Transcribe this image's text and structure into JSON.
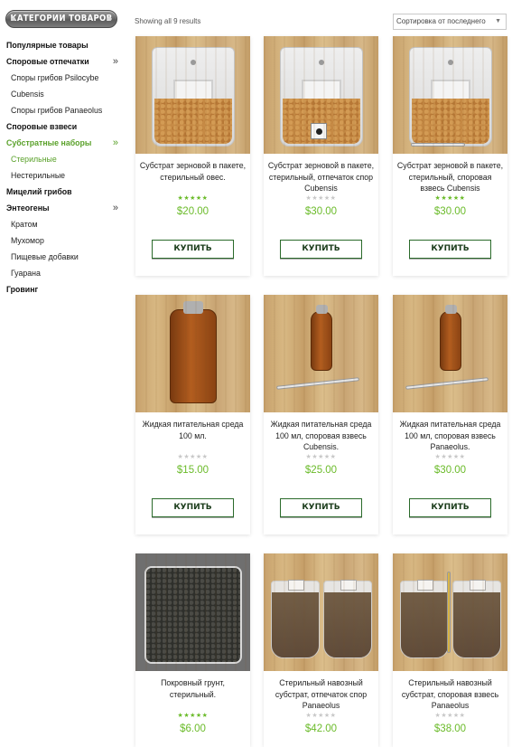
{
  "sidebar": {
    "header": "Категории товаров",
    "items": [
      {
        "label": "Популярные товары",
        "level": "top",
        "chevron": false,
        "active": false
      },
      {
        "label": "Споровые отпечатки",
        "level": "top",
        "chevron": true,
        "active": false
      },
      {
        "label": "Споры грибов Psilocybe",
        "level": "sub",
        "chevron": false,
        "active": false
      },
      {
        "label": "Cubensis",
        "level": "sub",
        "chevron": false,
        "active": false
      },
      {
        "label": "Споры грибов Panaeolus",
        "level": "sub",
        "chevron": false,
        "active": false
      },
      {
        "label": "Споровые взвеси",
        "level": "top",
        "chevron": false,
        "active": false
      },
      {
        "label": "Субстратные наборы",
        "level": "top",
        "chevron": true,
        "active": true
      },
      {
        "label": "Стерильные",
        "level": "sub",
        "chevron": false,
        "active": true
      },
      {
        "label": "Нестерильные",
        "level": "sub",
        "chevron": false,
        "active": false
      },
      {
        "label": "Мицелий грибов",
        "level": "top",
        "chevron": false,
        "active": false
      },
      {
        "label": "Энтеогены",
        "level": "top",
        "chevron": true,
        "active": false
      },
      {
        "label": "Кратом",
        "level": "sub",
        "chevron": false,
        "active": false
      },
      {
        "label": "Мухомор",
        "level": "sub",
        "chevron": false,
        "active": false
      },
      {
        "label": "Пищевые добавки",
        "level": "sub",
        "chevron": false,
        "active": false
      },
      {
        "label": "Гуарана",
        "level": "sub",
        "chevron": false,
        "active": false
      },
      {
        "label": "Гровинг",
        "level": "top",
        "chevron": false,
        "active": false
      }
    ]
  },
  "toolbar": {
    "result_count": "Showing all 9 results",
    "sort_selected": "Сортировка от последнего"
  },
  "products": [
    {
      "title": "Субстрат зерновой в пакете, стерильный овес.",
      "price": "$20.00",
      "rating": 5,
      "button": "Купить",
      "image": "grain-bag"
    },
    {
      "title": "Субстрат зерновой в пакете, стерильный, отпечаток спор Cubensis",
      "price": "$30.00",
      "rating": 0,
      "button": "Купить",
      "image": "grain-bag-spore-print"
    },
    {
      "title": "Субстрат зерновой в пакете, стерильный, споровая взвесь Cubensis",
      "price": "$30.00",
      "rating": 5,
      "button": "Купить",
      "image": "grain-bag-syringe"
    },
    {
      "title": "Жидкая питательная среда 100 мл.",
      "price": "$15.00",
      "rating": 0,
      "button": "Купить",
      "image": "liquid-bottle"
    },
    {
      "title": "Жидкая питательная среда 100 мл, споровая взвесь Cubensis.",
      "price": "$25.00",
      "rating": 0,
      "button": "Купить",
      "image": "liquid-bottle-syringe"
    },
    {
      "title": "Жидкая питательная среда 100 мл, споровая взвесь Panaeolus.",
      "price": "$30.00",
      "rating": 0,
      "button": "Купить",
      "image": "liquid-bottle-syringe"
    },
    {
      "title": "Покровный грунт, стерильный.",
      "price": "$6.00",
      "rating": 5,
      "button": "Купить",
      "image": "casing-soil-pack"
    },
    {
      "title": "Стерильный навозный субстрат, отпечаток спор Panaeolus",
      "price": "$42.00",
      "rating": 0,
      "button": "Купить",
      "image": "manure-cups"
    },
    {
      "title": "Стерильный навозный субстрат, споровая взвесь Panaeolus",
      "price": "$38.00",
      "rating": 0,
      "button": "Купить",
      "image": "manure-cups-syringe"
    }
  ],
  "colors": {
    "accent_green": "#6bbb2a",
    "button_border": "#2a6a2a"
  }
}
